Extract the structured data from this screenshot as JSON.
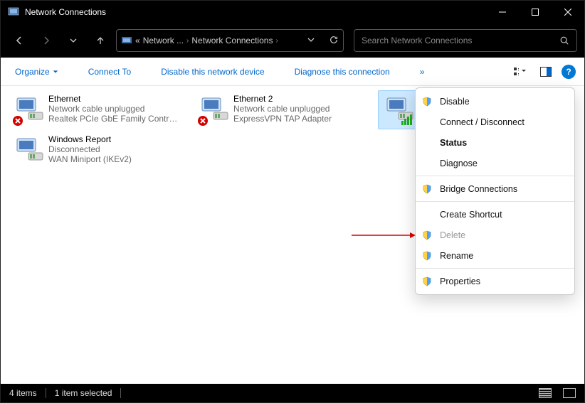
{
  "window": {
    "title": "Network Connections"
  },
  "breadcrumb": {
    "prefix": "«",
    "seg1": "Network ...",
    "seg2": "Network Connections"
  },
  "search": {
    "placeholder": "Search Network Connections"
  },
  "commands": {
    "organize": "Organize",
    "connect_to": "Connect To",
    "disable": "Disable this network device",
    "diagnose": "Diagnose this connection",
    "more": "»"
  },
  "connections": [
    {
      "name": "Ethernet",
      "status": "Network cable unplugged",
      "device": "Realtek PCIe GbE Family Controller",
      "badge": "x"
    },
    {
      "name": "Ethernet 2",
      "status": "Network cable unplugged",
      "device": "ExpressVPN TAP Adapter",
      "badge": "x"
    },
    {
      "name": "",
      "status": "",
      "device": "",
      "badge": "bars",
      "selected": true
    },
    {
      "name": "Windows Report",
      "status": "Disconnected",
      "device": "WAN Miniport (IKEv2)",
      "badge": ""
    }
  ],
  "context_menu": [
    {
      "label": "Disable",
      "shield": true
    },
    {
      "label": "Connect / Disconnect"
    },
    {
      "label": "Status",
      "bold": true
    },
    {
      "label": "Diagnose"
    },
    {
      "sep": true
    },
    {
      "label": "Bridge Connections",
      "shield": true
    },
    {
      "sep": true
    },
    {
      "label": "Create Shortcut"
    },
    {
      "label": "Delete",
      "shield": true,
      "disabled": true
    },
    {
      "label": "Rename",
      "shield": true
    },
    {
      "sep": true
    },
    {
      "label": "Properties",
      "shield": true
    }
  ],
  "statusbar": {
    "count": "4 items",
    "selected": "1 item selected"
  }
}
